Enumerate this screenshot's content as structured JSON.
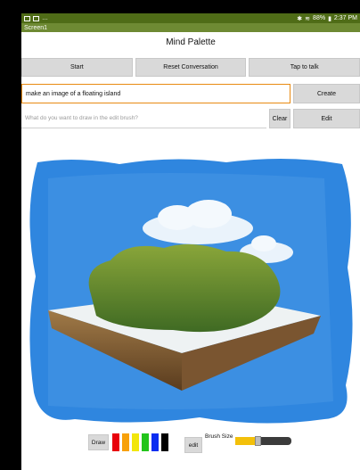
{
  "status_bar": {
    "left_glyph": "…",
    "battery": "88%",
    "time": "2:37 PM",
    "icons": [
      "notification-icon",
      "cast-icon",
      "bluetooth-icon",
      "wifi-icon",
      "battery-icon"
    ]
  },
  "screen_title": "Screen1",
  "app_title": "Mind Palette",
  "toolbar": {
    "start_label": "Start",
    "reset_label": "Reset Conversation",
    "talk_label": "Tap to talk"
  },
  "prompt": {
    "value": "make an image of a floating island",
    "create_label": "Create"
  },
  "edit_brush": {
    "placeholder": "What do you want to draw in the edit brush?",
    "clear_label": "Clear",
    "edit_label": "Edit"
  },
  "bottom_bar": {
    "draw_label": "Draw",
    "edit_label": "edit",
    "brush_size_label": "Brush Size",
    "brush_size_value": 0.4,
    "swatches": [
      "#e8000b",
      "#f7a10a",
      "#f2e60b",
      "#22c41b",
      "#0b2df1",
      "#000000"
    ]
  },
  "colors": {
    "status_bar": "#4f6c17",
    "title_bar": "#6e8a33",
    "prompt_border": "#e88a12",
    "slider_fill": "#f3c00a"
  }
}
